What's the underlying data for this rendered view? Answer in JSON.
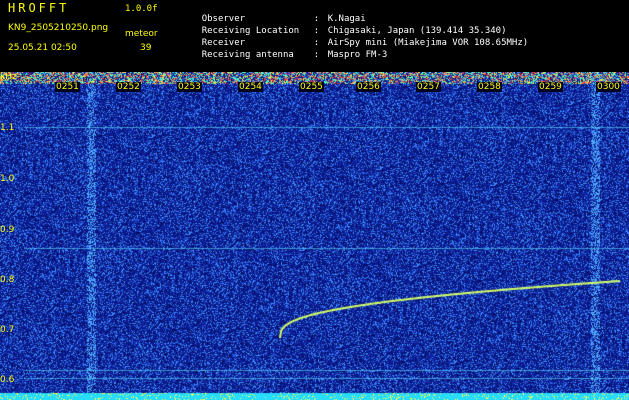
{
  "header": {
    "app_title": "HROFFT",
    "version": "1.0.0f",
    "filename": "KN9_2505210250.png",
    "datetime": "25.05.21 02:50",
    "mode": "meteor",
    "count": "39"
  },
  "info": [
    {
      "label": "Observer",
      "value": "K.Nagai"
    },
    {
      "label": "Receiving Location",
      "value": "Chigasaki, Japan (139.414 35.340)"
    },
    {
      "label": "Receiver",
      "value": "AirSpy mini (Miakejima VOR 108.65MHz)"
    },
    {
      "label": "Receiving antenna",
      "value": "Maspro FM-3"
    }
  ],
  "spectrogram": {
    "y_unit": "kHz",
    "y_ticks": [
      "1.1",
      "1.0",
      "0.9",
      "0.8",
      "0.7",
      "0.6"
    ],
    "time_ticks": [
      "0251",
      "0252",
      "0253",
      "0254",
      "0255",
      "0256",
      "0257",
      "0258",
      "0259",
      "0300"
    ],
    "colors": {
      "background": "#0a1a8c",
      "noise": "#4a8cff",
      "trace": "#ffff60",
      "label": "#ffff00"
    }
  }
}
